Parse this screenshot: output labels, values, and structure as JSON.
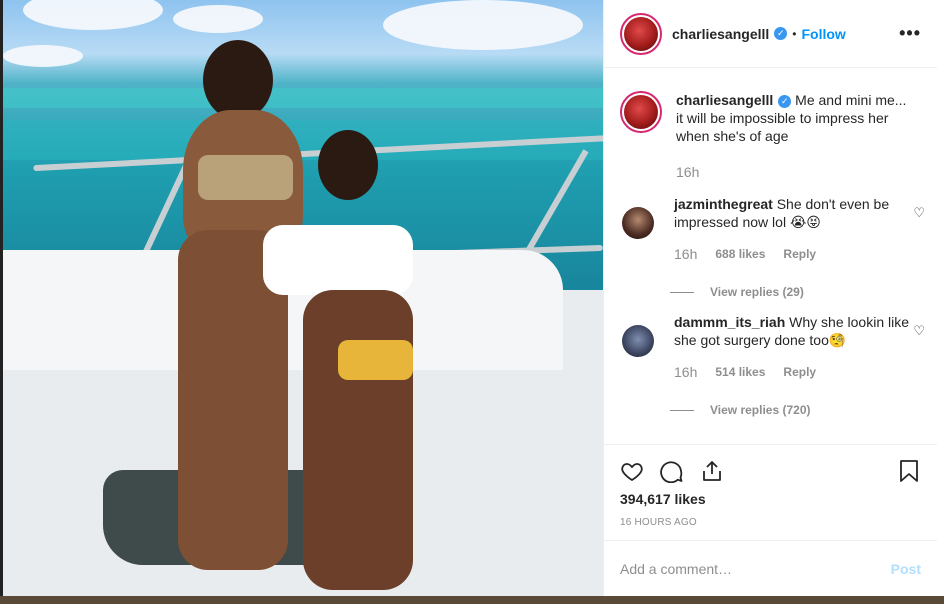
{
  "post": {
    "username": "charliesangelll",
    "verified_icon": "verified-badge-icon",
    "follow_label": "Follow",
    "separator": "•",
    "more_label": "•••",
    "caption_text": "Me and mini me... it will be impossible to impress her when she's of age",
    "caption_time": "16h",
    "likes": "394,617 likes",
    "posted_ago": "16 HOURS AGO"
  },
  "comments": [
    {
      "username": "jazminthegreat",
      "text": "She don't even be impressed now lol 😭😝",
      "time": "16h",
      "likes": "688 likes",
      "reply_label": "Reply",
      "view_replies": "View replies (29)"
    },
    {
      "username": "dammm_its_riah",
      "text": "Why she lookin like she got surgery done too🧐",
      "time": "16h",
      "likes": "514 likes",
      "reply_label": "Reply",
      "view_replies": "View replies (720)"
    }
  ],
  "composer": {
    "placeholder": "Add a comment…",
    "post_label": "Post"
  },
  "icons": {
    "like": "heart-icon",
    "comment": "comment-icon",
    "share": "share-icon",
    "save": "bookmark-icon"
  },
  "colors": {
    "link_blue": "#0095f6",
    "verified_blue": "#3897f0",
    "muted": "#8e8e8e",
    "post_disabled": "#b2dffc",
    "story_ring": "#d6286e"
  }
}
